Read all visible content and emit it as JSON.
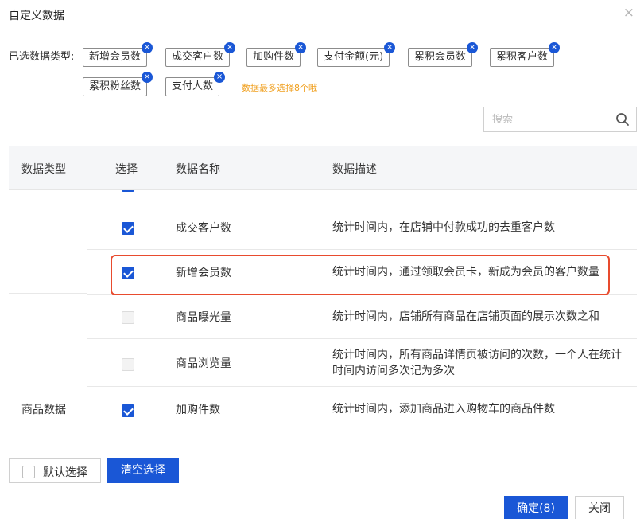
{
  "dialog": {
    "title": "自定义数据",
    "close_glyph": "×"
  },
  "selected": {
    "label": "已选数据类型:",
    "tags": [
      {
        "label": "新增会员数"
      },
      {
        "label": "成交客户数"
      },
      {
        "label": "加购件数"
      },
      {
        "label": "支付金额(元)"
      },
      {
        "label": "累积会员数"
      },
      {
        "label": "累积客户数"
      },
      {
        "label": "累积粉丝数"
      },
      {
        "label": "支付人数"
      }
    ],
    "remove_glyph": "×",
    "hint": "数据最多选择8个哦"
  },
  "search": {
    "placeholder": "搜索"
  },
  "table": {
    "headers": {
      "type": "数据类型",
      "select": "选择",
      "name": "数据名称",
      "desc": "数据描述"
    },
    "rows": [
      {
        "checked": true,
        "name": "成交客户数",
        "desc": "统计时间内，在店铺中付款成功的去重客户数"
      },
      {
        "checked": true,
        "name": "新增会员数",
        "desc": "统计时间内，通过领取会员卡，新成为会员的客户数量"
      },
      {
        "checked": false,
        "name": "商品曝光量",
        "desc": "统计时间内，店铺所有商品在店铺页面的展示次数之和"
      },
      {
        "checked": false,
        "name": "商品浏览量",
        "desc": "统计时间内，所有商品详情页被访问的次数，一个人在统计时间内访问多次记为多次"
      },
      {
        "checked": true,
        "name": "加购件数",
        "desc": "统计时间内，添加商品进入购物车的商品件数"
      }
    ],
    "group_label": "商品数据"
  },
  "footer": {
    "default_select": "默认选择",
    "clear": "清空选择",
    "ok": "确定(8)",
    "cancel": "关闭"
  },
  "colors": {
    "primary": "#1a57d6",
    "hint": "#f0a020",
    "highlight": "#e84b2e"
  }
}
